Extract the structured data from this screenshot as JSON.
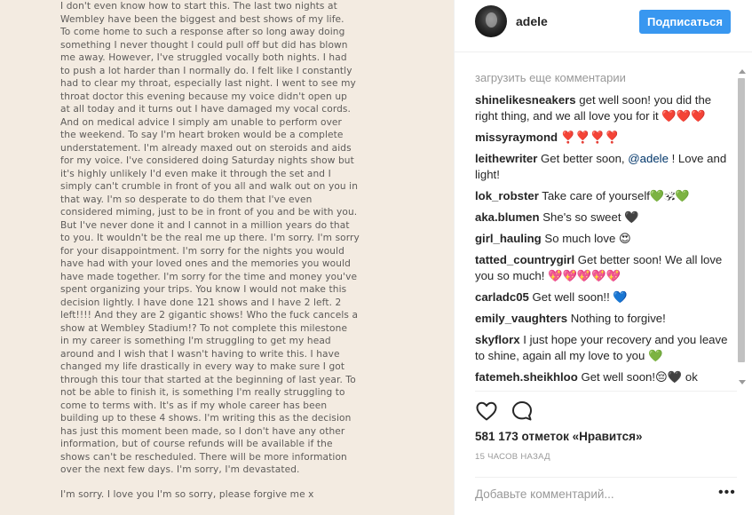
{
  "letter": {
    "lines": [
      "I don't even know how to start this. The last two nights at",
      "Wembley have been the biggest and best shows of my life.",
      "To come home to such a response after so long away doing",
      "something I never thought I could pull off but did has blown",
      "me away. However, I've struggled vocally both nights. I had",
      "to push a lot harder than I normally do. I felt like I constantly",
      "had to clear my throat, especially last night. I went to see my",
      "throat doctor this evening because my voice didn't open up",
      "at all today and it turns out I have damaged my vocal cords.",
      "And on medical advice I simply am unable to perform over",
      "the weekend. To say I'm heart broken would be a complete",
      "understatement. I'm already maxed out on steroids and aids",
      "for my voice. I've considered doing Saturday nights show but",
      "it's highly unlikely I'd even make it through the set and I",
      "simply can't crumble in front of you all and walk out on you in",
      "that way. I'm so desperate to do them that I've even",
      "considered miming, just to be in front of you and be with you.",
      "But I've never done it and I cannot in a million years do that",
      "to you. It wouldn't be the real me up there. I'm sorry. I'm sorry",
      "for your disappointment. I'm sorry for the nights you would",
      "have had with your loved ones and the memories you would",
      "have made together. I'm sorry for the time and money you've",
      "spent organizing your trips. You know I would not make this",
      "decision lightly. I have done 121 shows and I have 2 left. 2",
      "left!!!! And they are 2 gigantic shows! Who the fuck cancels a",
      "show at Wembley Stadium!? To not complete this milestone",
      "in my career is something I'm struggling to get my head",
      "around and I wish that I wasn't having to write this. I have",
      "changed my life drastically in every way to make sure I got",
      "through this tour that started at the beginning of last year. To",
      "not be able to finish it, is something I'm really struggling to",
      "come to terms with. It's as if my whole career has been",
      "building up to these 4 shows. I'm writing this as the decision",
      "has just this moment been made, so I don't have any other",
      "information, but of course refunds will be available if the",
      "shows can't be rescheduled. There will be more information",
      "over the next few days. I'm sorry, I'm devastated."
    ],
    "closing": "I'm sorry. I love you I'm so sorry, please forgive me x"
  },
  "header": {
    "username": "adele",
    "follow_label": "Подписаться"
  },
  "comments": {
    "load_more": "загрузить еще комментарии",
    "items": [
      {
        "user": "shinelikesneakers",
        "text": " get well soon! you did the right thing, and we all love you for it ❤️❤️❤️"
      },
      {
        "user": "missyraymond",
        "text": " ❣️❣️❣️❣️"
      },
      {
        "user": "leithewriter",
        "text": " Get better soon, ",
        "mention": "@adele",
        "text_after": " ! Love and light!"
      },
      {
        "user": "lok_robster",
        "text": " Take care of yourself💚🕉💚"
      },
      {
        "user": "aka.blumen",
        "text": " She's so sweet 🖤"
      },
      {
        "user": "girl_hauling",
        "text": " So much love 😍"
      },
      {
        "user": "tatted_countrygirl",
        "text": " Get better soon! We all love you so much! 💖💖💖💖💖"
      },
      {
        "user": "carladc05",
        "text": " Get well soon!! 💙"
      },
      {
        "user": "emily_vaughters",
        "text": " Nothing to forgive!"
      },
      {
        "user": "skyflorx",
        "text": " I just hope your recovery and you leave to shine, again all my love to you 💚"
      },
      {
        "user": "fatemeh.sheikhloo",
        "text": " Get well soon!😔🖤 ok"
      }
    ]
  },
  "actions": {
    "like_icon": "heart-outline-icon",
    "comment_icon": "speech-bubble-icon"
  },
  "likes": "581 173 отметок «Нравится»",
  "time": "15 ЧАСОВ НАЗАД",
  "comment_input": {
    "placeholder": "Добавьте комментарий...",
    "more_label": "•••"
  }
}
